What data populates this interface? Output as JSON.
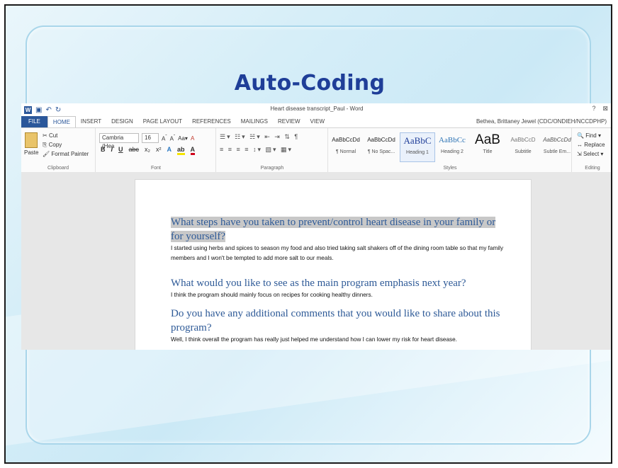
{
  "slide": {
    "title": "Auto-Coding"
  },
  "word": {
    "window_title": "Heart disease transcript_Paul - Word",
    "window_controls": [
      "?",
      "⊠"
    ],
    "user": "Bethea, Brittaney Jewel (CDC/ONDIEH/NCCDPHP)",
    "tabs": [
      "FILE",
      "HOME",
      "INSERT",
      "DESIGN",
      "PAGE LAYOUT",
      "REFERENCES",
      "MAILINGS",
      "REVIEW",
      "VIEW"
    ],
    "active_tab": "HOME",
    "ribbon": {
      "clipboard": {
        "paste": "Paste",
        "cut": "Cut",
        "copy": "Copy",
        "format_painter": "Format Painter",
        "label": "Clipboard"
      },
      "font": {
        "name": "Cambria (Hea",
        "size": "16",
        "label": "Font"
      },
      "paragraph": {
        "label": "Paragraph"
      },
      "styles": {
        "label": "Styles",
        "items": [
          {
            "sample": "AaBbCcDd",
            "name": "¶ Normal"
          },
          {
            "sample": "AaBbCcDd",
            "name": "¶ No Spac..."
          },
          {
            "sample": "AaBbC",
            "name": "Heading 1"
          },
          {
            "sample": "AaBbCc",
            "name": "Heading 2"
          },
          {
            "sample": "AaB",
            "name": "Title"
          },
          {
            "sample": "AaBbCcD",
            "name": "Subtitle"
          },
          {
            "sample": "AaBbCcDd",
            "name": "Subtle Em..."
          }
        ]
      },
      "editing": {
        "find": "Find",
        "replace": "Replace",
        "select": "Select",
        "label": "Editing"
      }
    },
    "document": {
      "q1": "What steps have you taken to prevent/control heart disease in your family or for yourself?",
      "a1": "I started using herbs and spices to season my food and also tried taking salt shakers off of the dining room table so that my family members and I won't be tempted to add more salt to our meals.",
      "q2": "What would you like to see as the main program emphasis next year?",
      "a2": "I think the program should mainly focus on recipes for cooking healthy dinners.",
      "q3": "Do you have any additional comments that you would like to share about this program?",
      "a3": "Well, I think overall the program has really just helped me understand how I can lower my risk for heart disease."
    }
  }
}
